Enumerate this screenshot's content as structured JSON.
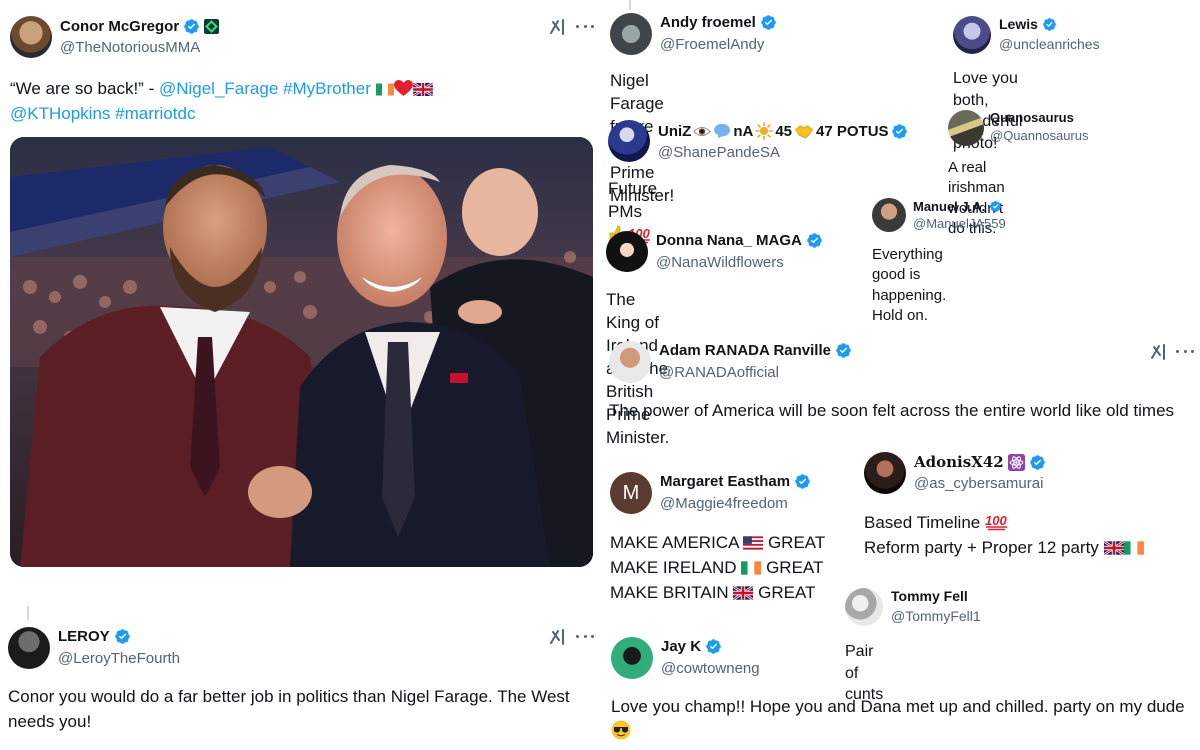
{
  "main_post": {
    "name": "Conor McGregor",
    "handle": "@TheNotoriousMMA",
    "text_quote": "“We are so back!” - ",
    "mention1": "@Nigel_Farage",
    "hashtag1": "#MyBrother",
    "mention2": "@KTHopkins",
    "hashtag2": "#marriotdc",
    "photo_alt": "photo"
  },
  "replies": {
    "leroy": {
      "name": "LEROY",
      "handle": "@LeroyTheFourth",
      "text": "Conor you would do a far better job in politics than Nigel Farage. The West needs you!"
    },
    "andy": {
      "name": "Andy froemel",
      "handle": "@FroemelAndy",
      "text": "Nigel Farage future UK Prime Minister!"
    },
    "lewis": {
      "name": "Lewis",
      "handle": "@uncleanriches",
      "text": "Love you both, wonderful photo!"
    },
    "uniz": {
      "name_a": "UniZ",
      "name_b": "nA",
      "name_c": "45",
      "name_d": "47 POTUS",
      "handle": "@ShanePandeSA",
      "text": "Future PMs"
    },
    "quanosaurus": {
      "name": "Quanosaurus",
      "handle": "@Quannosaurus",
      "text": "A real irishman wouldn’t do this."
    },
    "manuel": {
      "name": "Manuel J.A.",
      "handle": "@ManuelJA559",
      "text": "Everything good is happening. Hold on."
    },
    "donna": {
      "name": "Donna Nana_ MAGA",
      "handle": "@NanaWildflowers",
      "text": "The King of Ireland and The British Prime Minister."
    },
    "adam": {
      "name": "Adam RANADA Ranville",
      "handle": "@RANADAofficial",
      "text": "The power of America will be soon felt across the entire world like old times"
    },
    "margaret": {
      "name": "Margaret Eastham",
      "handle": "@Maggie4freedom",
      "avatar_letter": "M",
      "line1_a": "MAKE AMERICA",
      "line1_b": "GREAT",
      "line2_a": "MAKE IRELAND",
      "line2_b": "GREAT",
      "line3_a": "MAKE BRITAIN",
      "line3_b": "GREAT"
    },
    "adonis": {
      "name": "AdonisX42",
      "handle": "@as_cybersamurai",
      "line1": "Based Timeline",
      "line2": "Reform party + Proper 12 party"
    },
    "tommy": {
      "name": "Tommy Fell",
      "handle": "@TommyFell1",
      "text": "Pair of cunts"
    },
    "jayk": {
      "name": "Jay K",
      "handle": "@cowtowneng",
      "text": "Love you champ!! Hope you and Dana met up and chilled. party on my dude"
    }
  },
  "colors": {
    "verified": "#1d9bf0",
    "link": "#1d9bf0",
    "handle": "#536471",
    "text": "#0f1419"
  },
  "icons": [
    "verified-badge-icon",
    "grok-icon",
    "more-options-icon",
    "irish-flag-icon",
    "uk-flag-icon",
    "us-flag-icon",
    "red-heart-icon",
    "hundred-points-icon",
    "thumbs-up-icon",
    "sunglasses-face-icon",
    "eye-icon",
    "speech-bubble-icon",
    "sun-icon",
    "handshake-icon",
    "atom-icon"
  ]
}
